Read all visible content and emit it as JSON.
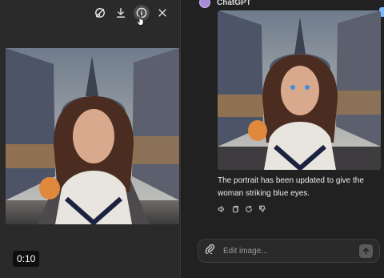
{
  "viewer": {
    "toolbar": [
      {
        "icon": "edit-brush-icon"
      },
      {
        "icon": "download-icon"
      },
      {
        "icon": "info-icon"
      },
      {
        "icon": "close-icon"
      }
    ],
    "timestamp": "0:10"
  },
  "chat": {
    "sender": "ChatGPT",
    "message": "The portrait has been updated to give the woman striking blue eyes.",
    "actions": [
      "speaker-icon",
      "copy-icon",
      "regenerate-icon",
      "thumbs-down-icon"
    ],
    "composer": {
      "placeholder": "Edit image..."
    }
  },
  "colors": {
    "accent": "#a98bd8",
    "background": "#212121",
    "panel": "#2a2a2a"
  }
}
